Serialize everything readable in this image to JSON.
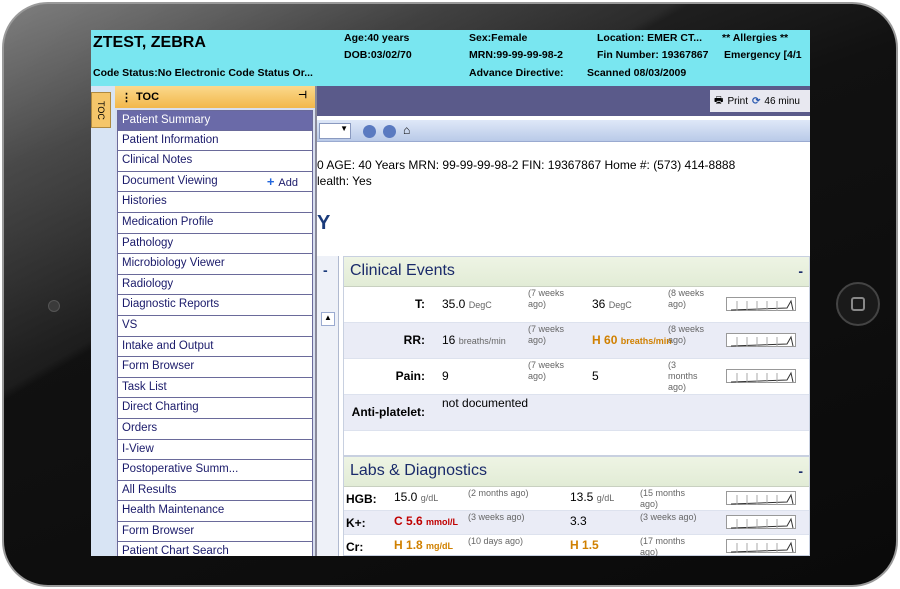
{
  "banner": {
    "patient_name": "ZTEST, ZEBRA",
    "code_status": "Code Status:No Electronic Code Status Or...",
    "age": "Age:40 years",
    "dob": "DOB:03/02/70",
    "sex": "Sex:Female",
    "mrn": "MRN:99-99-99-98-2",
    "location": "Location: EMER CT...",
    "allergies": "** Allergies **",
    "fin_number": "Fin Number: 19367867",
    "encounter": "Emergency [4/1",
    "advance_directive": "Advance Directive:",
    "scanned": "Scanned 08/03/2009"
  },
  "toolbar": {
    "print_label": "Print",
    "timer_label": "46 minu"
  },
  "side_tab": {
    "label": "TOC"
  },
  "toc": {
    "title": "TOC",
    "add_label": "Add",
    "items": [
      "Patient Summary",
      "Patient Information",
      "Clinical Notes",
      "Document Viewing",
      "Histories",
      "Medication Profile",
      "Pathology",
      "Microbiology Viewer",
      "Radiology",
      "Diagnostic Reports",
      "VS",
      "Intake and Output",
      "Form Browser",
      "Task List",
      "Direct Charting",
      "Orders",
      "I-View",
      "Postoperative Summ...",
      "All Results",
      "Health Maintenance",
      "Form Browser",
      "Patient Chart Search"
    ],
    "selected_index": 0
  },
  "patient_info": {
    "line1": "0   AGE: 40 Years    MRN: 99-99-99-98-2    FIN: 19367867    Home #: (573) 414-8888",
    "line2": "lealth: Yes",
    "big_letter": "Y"
  },
  "clinical_events": {
    "title": "Clinical Events",
    "rows": [
      {
        "label": "T:",
        "v1": "35.0",
        "u1": "DegC",
        "t1": "(7 weeks ago)",
        "v2": "36",
        "u2": "DegC",
        "flag2": "",
        "t2": "(8 weeks ago)"
      },
      {
        "label": "RR:",
        "v1": "16",
        "u1": "breaths/min",
        "t1": "(7 weeks ago)",
        "v2": "60",
        "u2": "breaths/min",
        "flag2": "H",
        "t2": "(8 weeks ago)"
      },
      {
        "label": "Pain:",
        "v1": "9",
        "u1": "",
        "t1": "(7 weeks ago)",
        "v2": "5",
        "u2": "",
        "flag2": "",
        "t2": "(3 months ago)"
      },
      {
        "label": "Anti-platelet:",
        "v1": "not documented",
        "u1": "",
        "t1": "",
        "v2": "",
        "u2": "",
        "flag2": "",
        "t2": ""
      }
    ]
  },
  "labs": {
    "title": "Labs & Diagnostics",
    "rows": [
      {
        "label": "HGB:",
        "flag1": "",
        "v1": "15.0",
        "u1": "g/dL",
        "t1": "(2 months ago)",
        "flag2": "",
        "v2": "13.5",
        "u2": "g/dL",
        "t2": "(15 months ago)"
      },
      {
        "label": "K+:",
        "flag1": "C",
        "v1": "5.6",
        "u1": "mmol/L",
        "t1": "(3 weeks ago)",
        "flag2": "",
        "v2": "3.3",
        "u2": "",
        "t2": "(3 weeks ago)"
      },
      {
        "label": "Cr:",
        "flag1": "H",
        "v1": "1.8",
        "u1": "mg/dL",
        "t1": "(10 days ago)",
        "flag2": "H",
        "v2": "1.5",
        "u2": "",
        "t2": "(17 months ago)"
      }
    ]
  },
  "colors": {
    "banner_bg": "#79e6f0",
    "toc_header": "#f2b74a",
    "selected_item": "#6a6aa8",
    "high_flag": "#d08000",
    "critical_flag": "#c00000"
  }
}
